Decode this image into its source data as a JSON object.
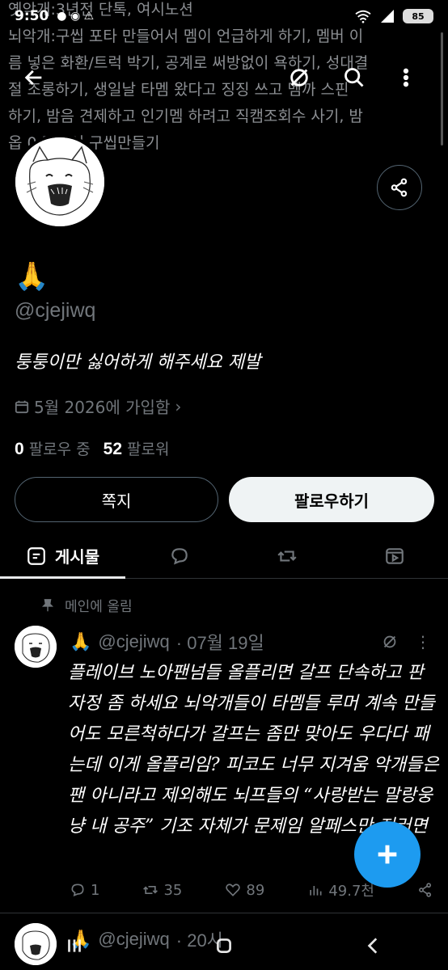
{
  "status_bar": {
    "time": "9:50",
    "battery": "85"
  },
  "banner": {
    "lines": [
      "옛악개:3년전 단톡, 여시노션",
      "뇌악개:구씹 포타 만들어서 멤이 언급하게 하기, 멤버 이",
      "름 넣은 화환/트럭 박기, 공계로 써방없이 욕하기, 성대결",
      "절 조롱하기, 생일날 타멤 왔다고 징징 쓰고 멤까 스핀",
      "하기, 밤음 견제하고 인기멤 하려고 직캠조회수 사기, 밤",
      "옵 0 털어서 구씹만들기"
    ]
  },
  "profile": {
    "display_name": "🙏",
    "handle": "@cjejiwq",
    "bio": "퉁퉁이만 싫어하게 해주세요 제발",
    "joined": "5월 2026에 가입함",
    "following_count": "0",
    "following_label": "팔로우 중",
    "followers_count": "52",
    "followers_label": "팔로워"
  },
  "buttons": {
    "dm": "쪽지",
    "follow": "팔로우하기"
  },
  "tabs": {
    "posts": "게시물"
  },
  "pinned_label": "메인에 올림",
  "tweets": [
    {
      "name": "🙏",
      "handle": "@cjejiwq",
      "date": "· 07월 19일",
      "body": "플레이브 노아팬넘들 올플리면 갈프 단속하고 판 자정 좀 하세요 뇌악개들이 타멤들 루머 계속 만들어도 모른척하다가 갈프는 좀만 맞아도 우다다 패는데 이게 올플리임? 피코도 너무 지겨움 악개들은 팬 아니라고 제외해도 뇌프들의 “사랑받는 말랑웅냥 내 공주” 기조 자체가 문제임 알페스만 저러면",
      "replies": "1",
      "reposts": "35",
      "likes": "89",
      "views": "49.7천"
    },
    {
      "name": "🙏",
      "handle": "@cjejiwq",
      "date": "· 20시"
    }
  ]
}
